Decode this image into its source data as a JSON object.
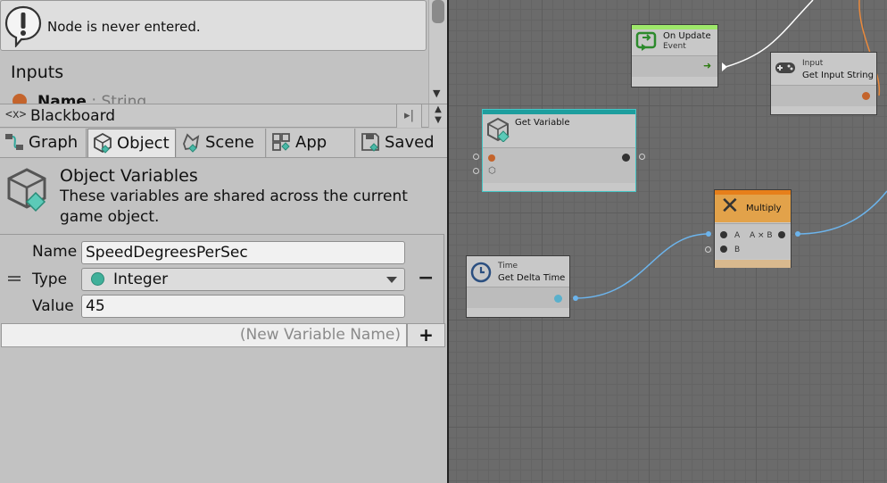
{
  "inspector": {
    "warning": "Node is never entered.",
    "inputs_title": "Inputs",
    "input_name": "Name",
    "input_type": ": String"
  },
  "blackboard": {
    "title": "Blackboard",
    "icon_text": "<x>",
    "tabs": [
      {
        "label": "Graph",
        "icon": "graph-icon",
        "active": false
      },
      {
        "label": "Object",
        "icon": "object-icon",
        "active": true
      },
      {
        "label": "Scene",
        "icon": "scene-icon",
        "active": false
      },
      {
        "label": "App",
        "icon": "app-icon",
        "active": false
      },
      {
        "label": "Saved",
        "icon": "saved-icon",
        "active": false
      }
    ],
    "scope_title": "Object Variables",
    "scope_description": "These variables are shared across the current game object.",
    "variable": {
      "name_label": "Name",
      "name_value": "SpeedDegreesPerSec",
      "type_label": "Type",
      "type_value": "Integer",
      "value_label": "Value",
      "value_value": "45",
      "remove_label": "−"
    },
    "new_variable_placeholder": "(New Variable Name)",
    "add_label": "+"
  },
  "graph": {
    "nodes": {
      "on_update": {
        "name": "On Update",
        "category": "Event"
      },
      "get_input": {
        "category": "Input",
        "name": "Get Input String"
      },
      "get_variable": {
        "name": "Get Variable"
      },
      "multiply": {
        "name": "Multiply",
        "port_a": "A",
        "port_b": "B",
        "output": "A × B"
      },
      "time": {
        "category": "Time",
        "name": "Get Delta Time"
      }
    }
  },
  "colors": {
    "event_header": "#9ee86a",
    "variable_header": "#1d9e9e",
    "math_header": "#e2a24a",
    "wire_blue": "#6cb4ec",
    "wire_orange": "#e9893c",
    "integer_type": "#40b09a",
    "string_port": "#c4642c"
  }
}
